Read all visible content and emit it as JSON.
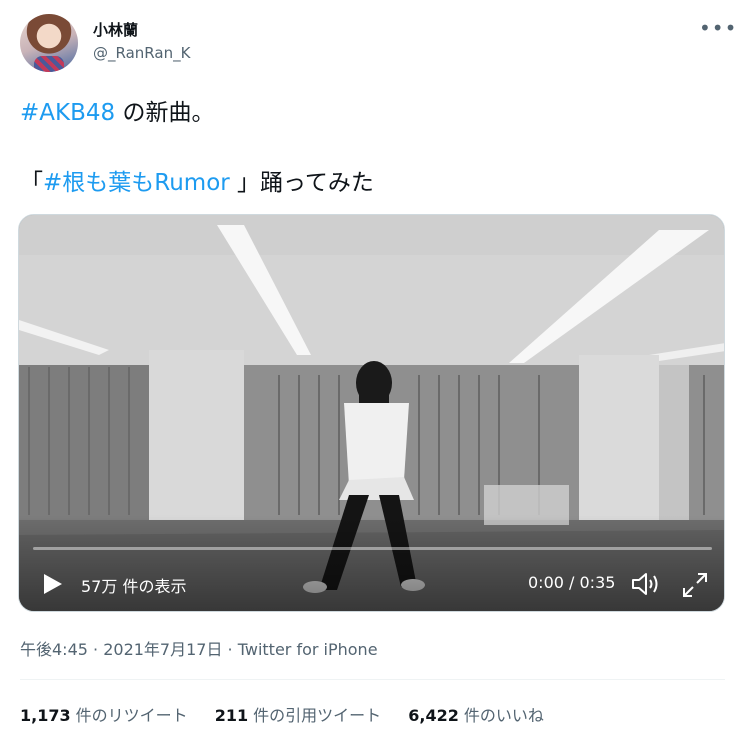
{
  "author": {
    "name": "小林蘭",
    "handle": "@_RanRan_K"
  },
  "tweet": {
    "hashtag1": "#AKB48",
    "line1_rest": " の新曲。",
    "line2_open": "「",
    "hashtag2": "#根も葉もRumor",
    "line2_rest": " 」踊ってみた"
  },
  "video": {
    "views": "57万 件の表示",
    "time": "0:00 / 0:35",
    "progress": 0.0
  },
  "meta": {
    "time": "午後4:45",
    "date": "2021年7月17日",
    "source": "Twitter for iPhone",
    "sep": " · "
  },
  "stats": {
    "retweets_count": "1,173",
    "retweets_label": "件のリツイート",
    "quotes_count": "211",
    "quotes_label": "件の引用ツイート",
    "likes_count": "6,422",
    "likes_label": "件のいいね"
  },
  "icons": {
    "more": "more-icon",
    "play": "play-icon",
    "volume": "volume-icon",
    "fullscreen": "fullscreen-icon"
  },
  "colors": {
    "accent": "#1d9bf0",
    "secondary_text": "#536471"
  }
}
